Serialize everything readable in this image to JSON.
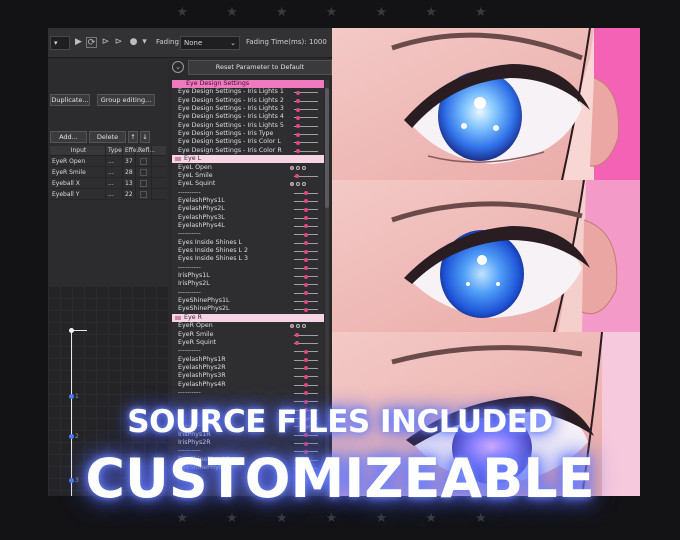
{
  "decor": {
    "stars_top": "★ ★ ★ ★ ★ ★ ★",
    "stars_bottom": "★ ★ ★ ★ ★ ★ ★"
  },
  "toolbar": {
    "fading_label": "Fading:",
    "fading_value": "None",
    "fading_time_label": "Fading Time(ms):",
    "fading_time_value": "1000"
  },
  "reset_button": "Reset Parameter to Default",
  "buttons": {
    "duplicate": "Duplicate...",
    "group_editing": "Group editing...",
    "add": "Add...",
    "delete": "Delete",
    "up": "↑",
    "down": "↓"
  },
  "input_table": {
    "headers": [
      "Input",
      "Type",
      "Effe...",
      "Refl..."
    ],
    "rows": [
      {
        "input": "EyeR Open",
        "type": "...",
        "effect": "37"
      },
      {
        "input": "EyeR Smile",
        "type": "...",
        "effect": "28"
      },
      {
        "input": "Eyeball X",
        "type": "...",
        "effect": "13"
      },
      {
        "input": "Eyeball Y",
        "type": "...",
        "effect": "22"
      }
    ]
  },
  "graph": {
    "marks": [
      "1",
      "2",
      "3"
    ]
  },
  "params": [
    {
      "label": "Eye Design Settings",
      "kind": "hdr"
    },
    {
      "label": "Eye Design Settings - Iris Lights 1",
      "kind": "item",
      "knob": 0.1
    },
    {
      "label": "Eye Design Settings - Iris Lights 2",
      "kind": "item",
      "knob": 0.1
    },
    {
      "label": "Eye Design Settings - Iris Lights 3",
      "kind": "item",
      "knob": 0.1
    },
    {
      "label": "Eye Design Settings - Iris Lights 4",
      "kind": "item",
      "knob": 0.1
    },
    {
      "label": "Eye Design Settings - Iris Lights 5",
      "kind": "item",
      "knob": 0.1
    },
    {
      "label": "Eye Design Settings - Iris Type",
      "kind": "item",
      "knob": 0.1
    },
    {
      "label": "Eye Design Settings - Iris Color L",
      "kind": "item",
      "knob": 0.1
    },
    {
      "label": "Eye Design Settings - Iris Color R",
      "kind": "item",
      "knob": 0.1
    },
    {
      "label": "Eye L",
      "kind": "group"
    },
    {
      "label": "EyeL Open",
      "kind": "dots"
    },
    {
      "label": "EyeL Smile",
      "kind": "item",
      "knob": 0.05
    },
    {
      "label": "EyeL Squint",
      "kind": "dots"
    },
    {
      "label": "----------",
      "kind": "item",
      "knob": 0.5
    },
    {
      "label": "EyelashPhys1L",
      "kind": "item",
      "knob": 0.5
    },
    {
      "label": "EyelashPhys2L",
      "kind": "item",
      "knob": 0.5
    },
    {
      "label": "EyelashPhys3L",
      "kind": "item",
      "knob": 0.5
    },
    {
      "label": "EyelashPhys4L",
      "kind": "item",
      "knob": 0.5
    },
    {
      "label": "----------",
      "kind": "item",
      "knob": 0.5
    },
    {
      "label": "Eyes Inside Shines L",
      "kind": "item",
      "knob": 0.5
    },
    {
      "label": "Eyes Inside Shines L 2",
      "kind": "item",
      "knob": 0.5
    },
    {
      "label": "Eyes Inside Shines L 3",
      "kind": "item",
      "knob": 0.5
    },
    {
      "label": "----------",
      "kind": "item",
      "knob": 0.5
    },
    {
      "label": "IrisPhys1L",
      "kind": "item",
      "knob": 0.5
    },
    {
      "label": "IrisPhys2L",
      "kind": "item",
      "knob": 0.5
    },
    {
      "label": "----------",
      "kind": "item",
      "knob": 0.5
    },
    {
      "label": "EyeShinePhys1L",
      "kind": "item",
      "knob": 0.5
    },
    {
      "label": "EyeShinePhys2L",
      "kind": "item",
      "knob": 0.5
    },
    {
      "label": "Eye R",
      "kind": "group"
    },
    {
      "label": "EyeR Open",
      "kind": "dots"
    },
    {
      "label": "EyeR Smile",
      "kind": "item",
      "knob": 0.05
    },
    {
      "label": "EyeR Squint",
      "kind": "item",
      "knob": 0.05
    },
    {
      "label": "----------",
      "kind": "item",
      "knob": 0.5
    },
    {
      "label": "EyelashPhys1R",
      "kind": "item",
      "knob": 0.5
    },
    {
      "label": "EyelashPhys2R",
      "kind": "item",
      "knob": 0.5
    },
    {
      "label": "EyelashPhys3R",
      "kind": "item",
      "knob": 0.5
    },
    {
      "label": "EyelashPhys4R",
      "kind": "item",
      "knob": 0.5
    },
    {
      "label": "----------",
      "kind": "item",
      "knob": 0.5
    },
    {
      "label": "",
      "kind": "item",
      "knob": 0.5
    },
    {
      "label": "",
      "kind": "item",
      "knob": 0.5
    },
    {
      "label": "",
      "kind": "item",
      "knob": 0.5
    },
    {
      "label": "----------",
      "kind": "item",
      "knob": 0.5
    },
    {
      "label": "IrisPhys1R",
      "kind": "item",
      "knob": 0.5
    },
    {
      "label": "IrisPhys2R",
      "kind": "item",
      "knob": 0.5
    },
    {
      "label": "----------",
      "kind": "item",
      "knob": 0.5
    },
    {
      "label": "EyeShinePhys1R",
      "kind": "item",
      "knob": 0.5
    },
    {
      "label": "EyeShinePhys2R",
      "kind": "item",
      "knob": 0.5
    }
  ],
  "overlay": {
    "line1": "SOURCE FILES INCLUDED",
    "line2": "CUSTOMIZEABLE"
  },
  "colors": {
    "accent_pink": "#f07ac0",
    "group_pink": "#f6d4e4",
    "knob": "#e0487f",
    "glow_blue": "#5b6dff",
    "iris_blue": "#2f7df0"
  }
}
